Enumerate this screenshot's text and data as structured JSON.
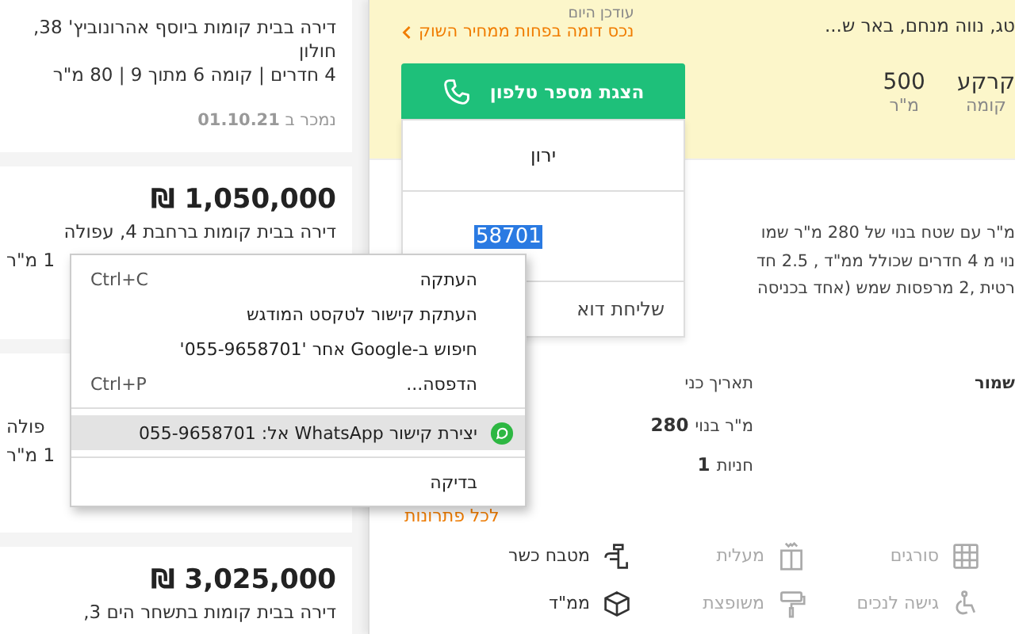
{
  "listings": [
    {
      "lines": [
        "דירה בבית קומות ביוסף אהרונוביץ' 38, חולון",
        "4 חדרים | קומה 6 מתוך 9 | 80 מ\"ר"
      ],
      "sold_label": "נמכר ב",
      "sold_date": "01.10.21"
    },
    {
      "price": "1,050,000 ₪",
      "lines": [
        "דירה בבית קומות ברחבת 4, עפולה"
      ],
      "tails": [
        "1 מ\"ר"
      ]
    },
    {
      "tails": [
        "פולה",
        "1 מ\"ר"
      ]
    },
    {
      "price": "3,025,000 ₪",
      "lines": [
        "דירה בבית קומות בתשחר הים 3,"
      ]
    }
  ],
  "property": {
    "updated": "עודכן היום",
    "similar_link": "נכס דומה בפחות ממחיר השוק",
    "address": "טג, נווה מנחם, באר ש...",
    "stats": [
      {
        "value": "קרקע",
        "label": "קומה"
      },
      {
        "value": "500",
        "label": "מ\"ר"
      }
    ],
    "phone_button": "הצגת מספר טלפון",
    "contact": {
      "name": "ירון",
      "phone": "58701",
      "phone_selected": true,
      "email_link": "שליחת דוא"
    },
    "description": [
      "מ\"ר עם שטח בנוי של 280 מ\"ר שמו",
      "נוי מ 4 חדרים שכולל ממ\"ד , 2.5 חד",
      "רטית ,2 מרפסות שמש (אחד בכניסה"
    ],
    "details": [
      {
        "label": "שמור"
      },
      {
        "label": "תאריך כני"
      },
      {
        "label": "מ\"ר בנוי",
        "value": "280"
      },
      {
        "label": "חניות",
        "value": "1"
      }
    ],
    "solutions_link": "לכל פתרונות",
    "features": [
      {
        "label": "סורגים",
        "available": false
      },
      {
        "label": "מעלית",
        "available": false
      },
      {
        "label": "מטבח כשר",
        "available": true
      },
      {
        "label": "גישה לנכים",
        "available": false
      },
      {
        "label": "משופצת",
        "available": false
      },
      {
        "label": "ממ\"ד",
        "available": true
      }
    ]
  },
  "context_menu": [
    {
      "kind": "item",
      "label": "העתקה",
      "shortcut": "Ctrl+C",
      "selected": false
    },
    {
      "kind": "item",
      "label": "העתקת קישור לטקסט המודגש",
      "selected": false
    },
    {
      "kind": "item",
      "label": "חיפוש ב-Google אחר '055-9658701'",
      "selected": false
    },
    {
      "kind": "item",
      "label": "הדפסה...",
      "shortcut": "Ctrl+P",
      "selected": false
    },
    {
      "kind": "separator"
    },
    {
      "kind": "whatsapp",
      "label": "יצירת קישור WhatsApp אל: 055-9658701",
      "selected": true
    },
    {
      "kind": "separator"
    },
    {
      "kind": "item",
      "label": "בדיקה",
      "selected": false
    }
  ]
}
